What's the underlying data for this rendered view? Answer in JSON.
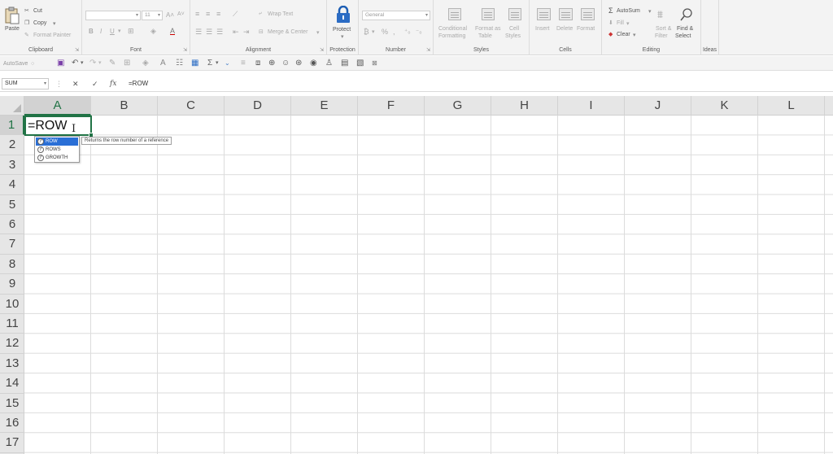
{
  "ribbon": {
    "clipboard": {
      "group_label": "Clipboard",
      "paste": "Paste",
      "cut": "Cut",
      "copy": "Copy",
      "format_painter": "Format Painter"
    },
    "font": {
      "group_label": "Font",
      "font_name": "",
      "font_size": "11"
    },
    "alignment": {
      "group_label": "Alignment",
      "wrap_text": "Wrap Text",
      "merge_center": "Merge & Center"
    },
    "protection": {
      "group_label": "Protection",
      "protect": "Protect"
    },
    "number": {
      "group_label": "Number",
      "format": "General"
    },
    "styles": {
      "group_label": "Styles",
      "conditional_formatting": [
        "Conditional",
        "Formatting"
      ],
      "format_as_table": [
        "Format as",
        "Table"
      ],
      "cell_styles": [
        "Cell",
        "Styles"
      ]
    },
    "cells": {
      "group_label": "Cells",
      "insert": "Insert",
      "delete": "Delete",
      "format": "Format"
    },
    "editing": {
      "group_label": "Editing",
      "autosum": "AutoSum",
      "fill": "Fill",
      "clear": "Clear",
      "sort_filter": [
        "Sort &",
        "Filter"
      ],
      "find_select": [
        "Find &",
        "Select"
      ]
    },
    "ideas": {
      "group_label": "Ideas"
    }
  },
  "qat": {
    "autosave": "AutoSave"
  },
  "formula_bar": {
    "name_box": "SUM",
    "cancel": "✕",
    "enter": "✓",
    "fx": "fx",
    "formula": "=ROW"
  },
  "grid": {
    "columns": [
      "A",
      "B",
      "C",
      "D",
      "E",
      "F",
      "G",
      "H",
      "I",
      "J",
      "K",
      "L"
    ],
    "rows": [
      "1",
      "2",
      "3",
      "4",
      "5",
      "6",
      "7",
      "8",
      "9",
      "10",
      "11",
      "12",
      "13",
      "14",
      "15",
      "16",
      "17"
    ],
    "active_cell_value": "=ROW"
  },
  "autocomplete": {
    "items": [
      "ROW",
      "ROWS",
      "GROWTH"
    ],
    "tooltip": "Returns the row number of a reference"
  },
  "colors": {
    "accent": "#217346",
    "selection": "#2a6fd6"
  }
}
